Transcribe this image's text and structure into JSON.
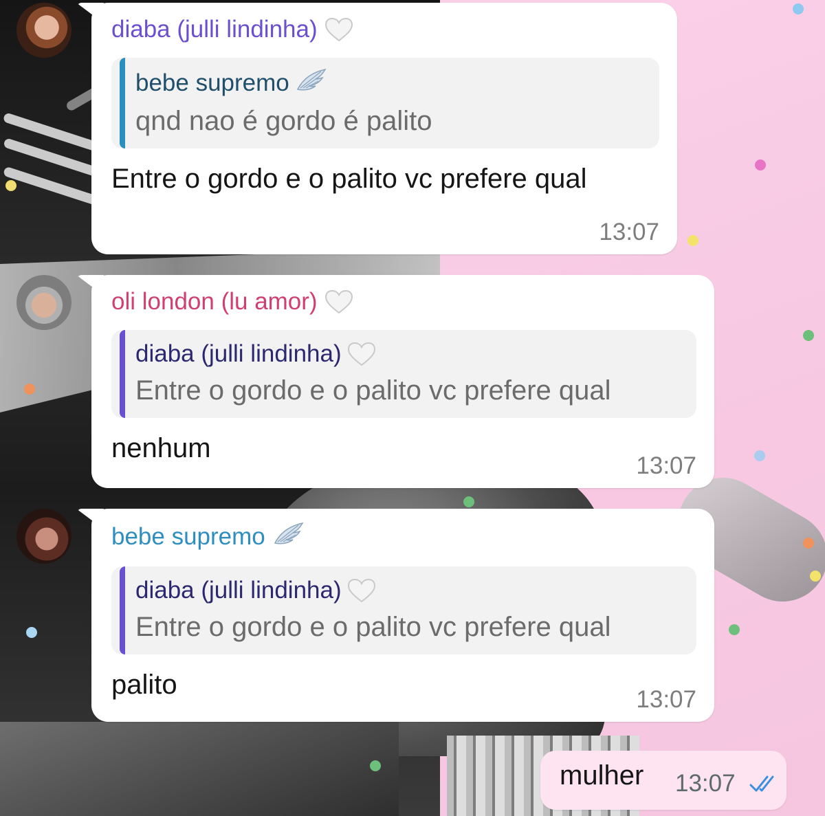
{
  "messages": [
    {
      "sender": "diaba (julli lindinha)",
      "sender_emoji": "white-heart",
      "reply_to": {
        "sender": "bebe supremo",
        "sender_emoji": "wing",
        "text": "qnd nao é gordo é palito"
      },
      "text": "Entre o gordo e o palito vc prefere qual",
      "time": "13:07"
    },
    {
      "sender": "oli london (lu amor)",
      "sender_emoji": "white-heart",
      "reply_to": {
        "sender": "diaba (julli lindinha)",
        "sender_emoji": "white-heart",
        "text": "Entre o gordo e o palito vc prefere qual"
      },
      "text": "nenhum",
      "time": "13:07"
    },
    {
      "sender": "bebe supremo",
      "sender_emoji": "wing",
      "reply_to": {
        "sender": "diaba (julli lindinha)",
        "sender_emoji": "white-heart",
        "text": "Entre o gordo e o palito vc prefere qual"
      },
      "text": "palito",
      "time": "13:07"
    }
  ],
  "outgoing": {
    "text": "mulher",
    "time": "13:07",
    "status": "read-double-check"
  },
  "colors": {
    "sender_purple": "#6a4fd0",
    "sender_pink": "#d13f6f",
    "sender_teal": "#2e8fbf",
    "outgoing_bubble": "#fde4f0",
    "read_ticks": "#3b8fe0"
  }
}
